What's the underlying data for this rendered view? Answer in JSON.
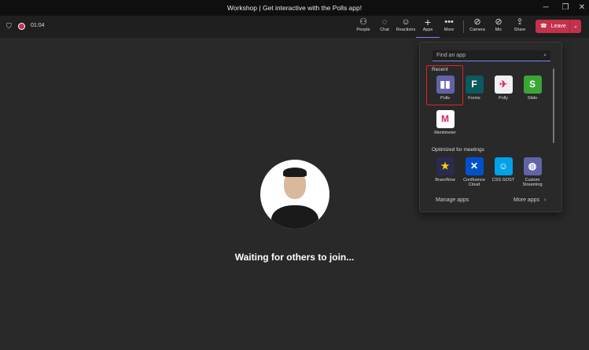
{
  "window": {
    "title": "Workshop | Get interactive with the Polls app!",
    "minimize": "─",
    "maximize": "❐",
    "close": "✕"
  },
  "toolbar": {
    "timer": "01:04",
    "people": "People",
    "chat": "Chat",
    "reactions": "Reactions",
    "apps": "Apps",
    "more": "More",
    "camera": "Camera",
    "mic": "Mic",
    "share": "Share",
    "leave": "Leave"
  },
  "apps_panel": {
    "search_placeholder": "Find an app",
    "recent_label": "Recent",
    "recent": [
      {
        "name": "Polls",
        "glyph": "▮▮",
        "color": "#6264a7"
      },
      {
        "name": "Forms",
        "glyph": "F",
        "color": "#0b5a5e"
      },
      {
        "name": "Polly",
        "glyph": "✈",
        "color": "#f0f0f0"
      },
      {
        "name": "Slido",
        "glyph": "S",
        "color": "#3aa635"
      },
      {
        "name": "Mentimeter",
        "glyph": "M",
        "color": "#ffffff"
      }
    ],
    "optimized_label": "Optimized for meetings",
    "optimized": [
      {
        "name": "BravoNow",
        "glyph": "★",
        "color": "#2b2b4f"
      },
      {
        "name": "Confluence Cloud",
        "glyph": "✕",
        "color": "#0052cc"
      },
      {
        "name": "CSS GOST",
        "glyph": "☺",
        "color": "#00a2e8"
      },
      {
        "name": "Custom Streaming",
        "glyph": "◍",
        "color": "#6264a7"
      }
    ],
    "manage_apps": "Manage apps",
    "more_apps": "More apps"
  },
  "stage": {
    "status": "Waiting for others to join..."
  }
}
